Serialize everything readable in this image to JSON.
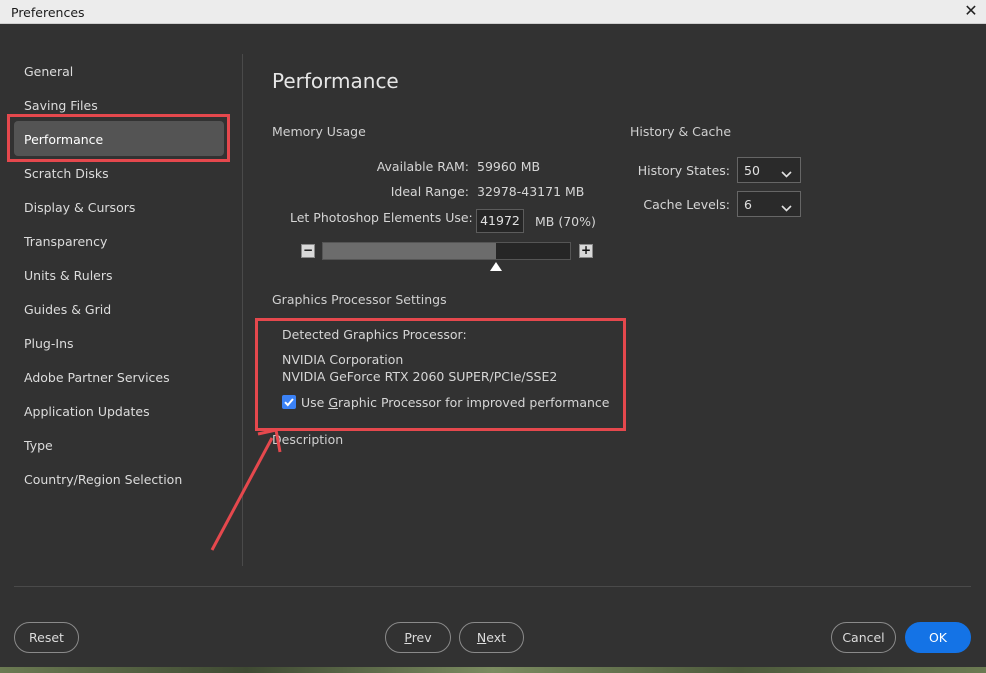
{
  "window": {
    "title": "Preferences",
    "close_icon": "close-icon"
  },
  "sidebar": {
    "items": [
      {
        "label": "General"
      },
      {
        "label": "Saving Files"
      },
      {
        "label": "Performance",
        "selected": true
      },
      {
        "label": "Scratch Disks"
      },
      {
        "label": "Display & Cursors"
      },
      {
        "label": "Transparency"
      },
      {
        "label": "Units & Rulers"
      },
      {
        "label": "Guides & Grid"
      },
      {
        "label": "Plug-Ins"
      },
      {
        "label": "Adobe Partner Services"
      },
      {
        "label": "Application Updates"
      },
      {
        "label": "Type"
      },
      {
        "label": "Country/Region Selection"
      }
    ]
  },
  "main": {
    "title": "Performance",
    "memory": {
      "heading": "Memory Usage",
      "available_label": "Available RAM:",
      "available_value": "59960 MB",
      "ideal_label": "Ideal Range:",
      "ideal_value": "32978-43171 MB",
      "let_label": "Let Photoshop Elements Use:",
      "let_value": "41972",
      "let_suffix": "MB (70%)",
      "slider_fraction": 0.7,
      "minus_label": "−",
      "plus_label": "+"
    },
    "history": {
      "heading": "History & Cache",
      "states_label": "History States:",
      "states_value": "50",
      "cache_label": "Cache Levels:",
      "cache_value": "6"
    },
    "gpu": {
      "heading": "Graphics Processor Settings",
      "detected_label": "Detected Graphics Processor:",
      "vendor": "NVIDIA Corporation",
      "model": "NVIDIA GeForce RTX 2060 SUPER/PCIe/SSE2",
      "use_gpu_pre": "Use ",
      "use_gpu_u": "G",
      "use_gpu_post": "raphic Processor for improved performance",
      "use_gpu_checked": true
    },
    "description_heading": "Description"
  },
  "footer": {
    "reset": "Reset",
    "prev_u": "P",
    "prev_rest": "rev",
    "next_u": "N",
    "next_rest": "ext",
    "cancel": "Cancel",
    "ok": "OK"
  },
  "colors": {
    "accent": "#1473e6",
    "highlight": "#e5484d",
    "checkbox": "#3b82f6"
  }
}
